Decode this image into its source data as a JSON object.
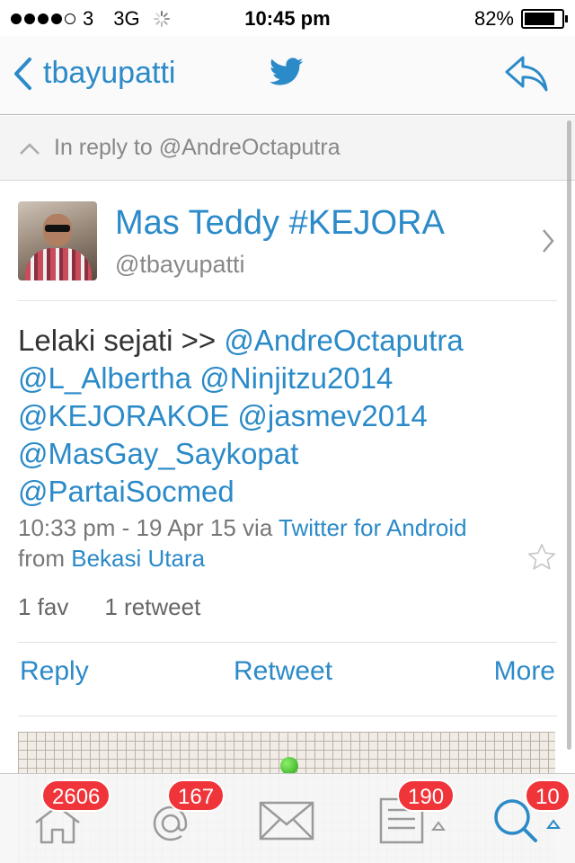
{
  "status_bar": {
    "carrier": "3",
    "network": "3G",
    "time": "10:45 pm",
    "battery": "82%",
    "battery_level": 0.82
  },
  "nav": {
    "back_label": "tbayupatti",
    "center_icon": "twitter-bird-icon",
    "right_icon": "reply-icon"
  },
  "in_reply": {
    "text": "In reply to @AndreOctaputra"
  },
  "profile": {
    "name": "Mas Teddy #KEJORA",
    "handle": "@tbayupatti"
  },
  "tweet": {
    "prefix": "Lelaki sejati >> ",
    "mentions": [
      "@AndreOctaputra",
      "@L_Albertha",
      "@Ninjitzu2014",
      "@KEJORAKOE",
      "@jasmev2014",
      "@MasGay_Saykopat",
      "@PartaiSocmed"
    ],
    "time": "10:33 pm - 19 Apr 15 via ",
    "client": "Twitter for Android",
    "from_label": "from ",
    "location": "Bekasi Utara"
  },
  "stats": {
    "favs": "1 fav",
    "retweets": "1 retweet"
  },
  "actions": {
    "reply": "Reply",
    "retweet": "Retweet",
    "more": "More"
  },
  "tab_bar": {
    "home_badge": "2606",
    "mentions_badge": "167",
    "messages_badge": "",
    "lists_badge": "190",
    "search_badge": "10"
  },
  "colors": {
    "accent": "#2b8ac8",
    "badge": "#f0353a"
  }
}
